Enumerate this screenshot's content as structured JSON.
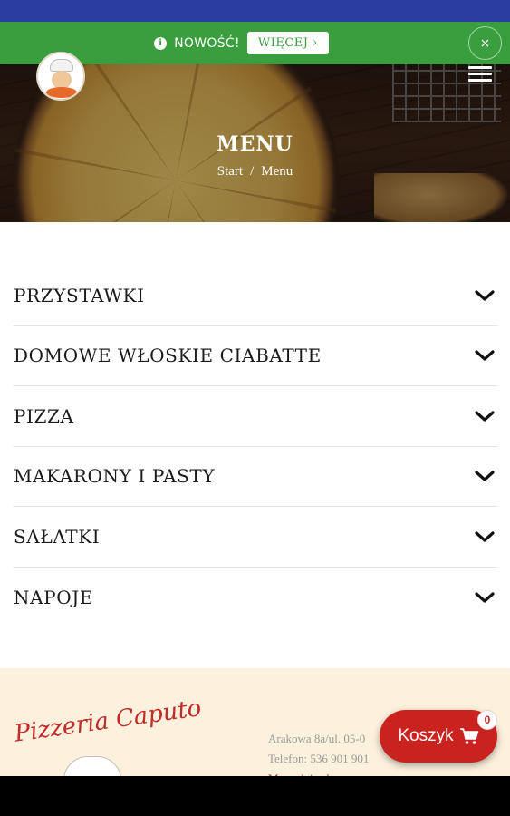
{
  "promo": {
    "text": "NOWOŚĆ!",
    "more_label": "WIĘCEJ ›",
    "close_label": "×"
  },
  "hero": {
    "title": "MENU",
    "breadcrumb": [
      "Start",
      "/",
      "Menu"
    ]
  },
  "menu": {
    "categories": [
      "PRZYSTAWKI",
      "DOMOWE WŁOSKIE CIABATTE",
      "PIZZA",
      "MAKARONY I PASTY",
      "SAŁATKI",
      "NAPOJE"
    ]
  },
  "footer": {
    "logo_text": "Pizzeria Caputo",
    "address": "Arakowa 8a/ul. 05-0",
    "phone": "Telefon: 536 901 901",
    "map_link": "Mapa dojazdu"
  },
  "cart": {
    "label": "Koszyk",
    "count": "0"
  },
  "colors": {
    "status_bar": "#2b3d9e",
    "promo_green": "#3a9d3e",
    "cart_red": "#c9221f",
    "footer_cream": "#fbf1dc"
  },
  "icons": [
    "info-icon",
    "close-icon",
    "hamburger-menu-icon",
    "chevron-down-icon",
    "cart-icon"
  ]
}
